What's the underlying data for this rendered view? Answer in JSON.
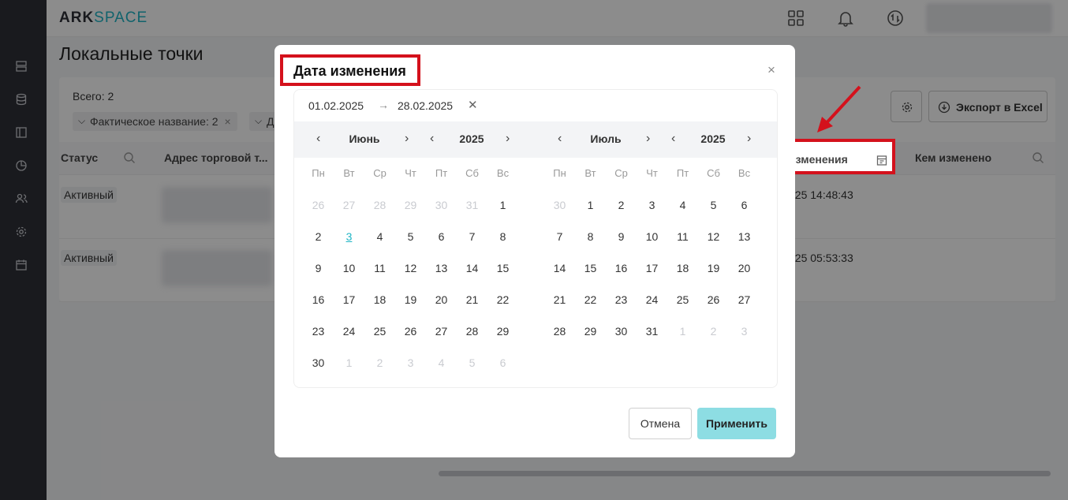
{
  "app": {
    "logo_part1": "ARK",
    "logo_part2": "SPACE"
  },
  "page": {
    "title": "Локальные точки"
  },
  "sidebar": {
    "items": [
      "server-icon",
      "database-icon",
      "layout-icon",
      "chart-icon",
      "users-icon",
      "gear-icon",
      "calendar-icon"
    ]
  },
  "toolbar": {
    "total": "Всего: 2",
    "filter_chip_1": "Фактическое название: 2",
    "filter_chip_2": "Д",
    "export_label": "Экспорт в Excel"
  },
  "table": {
    "columns": {
      "status": "Статус",
      "address": "Адрес торговой т...",
      "changed_date": "изменения",
      "changed_by": "Кем изменено"
    },
    "rows": [
      {
        "status": "Активный",
        "changed_date": "025 14:48:43"
      },
      {
        "status": "Активный",
        "changed_date": "025 05:53:33"
      }
    ]
  },
  "modal": {
    "title": "Дата изменения",
    "range_start": "01.02.2025",
    "range_arrow": "→",
    "range_end": "28.02.2025",
    "cancel_label": "Отмена",
    "apply_label": "Применить",
    "weekdays": [
      "Пн",
      "Вт",
      "Ср",
      "Чт",
      "Пт",
      "Сб",
      "Вс"
    ],
    "calendars": [
      {
        "month": "Июнь",
        "year": "2025",
        "today": "3",
        "weeks": [
          [
            [
              "26",
              0
            ],
            [
              "27",
              0
            ],
            [
              "28",
              0
            ],
            [
              "29",
              0
            ],
            [
              "30",
              0
            ],
            [
              "31",
              0
            ],
            [
              "1",
              1
            ]
          ],
          [
            [
              "2",
              1
            ],
            [
              "3",
              1
            ],
            [
              "4",
              1
            ],
            [
              "5",
              1
            ],
            [
              "6",
              1
            ],
            [
              "7",
              1
            ],
            [
              "8",
              1
            ]
          ],
          [
            [
              "9",
              1
            ],
            [
              "10",
              1
            ],
            [
              "11",
              1
            ],
            [
              "12",
              1
            ],
            [
              "13",
              1
            ],
            [
              "14",
              1
            ],
            [
              "15",
              1
            ]
          ],
          [
            [
              "16",
              1
            ],
            [
              "17",
              1
            ],
            [
              "18",
              1
            ],
            [
              "19",
              1
            ],
            [
              "20",
              1
            ],
            [
              "21",
              1
            ],
            [
              "22",
              1
            ]
          ],
          [
            [
              "23",
              1
            ],
            [
              "24",
              1
            ],
            [
              "25",
              1
            ],
            [
              "26",
              1
            ],
            [
              "27",
              1
            ],
            [
              "28",
              1
            ],
            [
              "29",
              1
            ]
          ],
          [
            [
              "30",
              1
            ],
            [
              "1",
              0
            ],
            [
              "2",
              0
            ],
            [
              "3",
              0
            ],
            [
              "4",
              0
            ],
            [
              "5",
              0
            ],
            [
              "6",
              0
            ]
          ]
        ]
      },
      {
        "month": "Июль",
        "year": "2025",
        "today": "",
        "weeks": [
          [
            [
              "30",
              0
            ],
            [
              "1",
              1
            ],
            [
              "2",
              1
            ],
            [
              "3",
              1
            ],
            [
              "4",
              1
            ],
            [
              "5",
              1
            ],
            [
              "6",
              1
            ]
          ],
          [
            [
              "7",
              1
            ],
            [
              "8",
              1
            ],
            [
              "9",
              1
            ],
            [
              "10",
              1
            ],
            [
              "11",
              1
            ],
            [
              "12",
              1
            ],
            [
              "13",
              1
            ]
          ],
          [
            [
              "14",
              1
            ],
            [
              "15",
              1
            ],
            [
              "16",
              1
            ],
            [
              "17",
              1
            ],
            [
              "18",
              1
            ],
            [
              "19",
              1
            ],
            [
              "20",
              1
            ]
          ],
          [
            [
              "21",
              1
            ],
            [
              "22",
              1
            ],
            [
              "23",
              1
            ],
            [
              "24",
              1
            ],
            [
              "25",
              1
            ],
            [
              "26",
              1
            ],
            [
              "27",
              1
            ]
          ],
          [
            [
              "28",
              1
            ],
            [
              "29",
              1
            ],
            [
              "30",
              1
            ],
            [
              "31",
              1
            ],
            [
              "1",
              0
            ],
            [
              "2",
              0
            ],
            [
              "3",
              0
            ]
          ]
        ]
      }
    ]
  },
  "colors": {
    "accent": "#1fb5c5",
    "apply_button": "#8ddde3",
    "highlight": "#d4111c",
    "sidebar": "#2e3038"
  }
}
